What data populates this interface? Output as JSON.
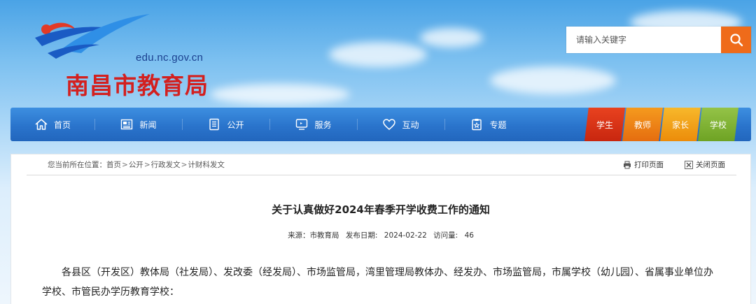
{
  "site": {
    "url": "edu.nc.gov.cn",
    "name": "南昌市教育局"
  },
  "search": {
    "placeholder": "请输入关键字",
    "icon": "search-icon"
  },
  "nav": {
    "items": [
      {
        "label": "首页",
        "icon": "home-icon"
      },
      {
        "label": "新闻",
        "icon": "newspaper-icon"
      },
      {
        "label": "公开",
        "icon": "document-list-icon"
      },
      {
        "label": "服务",
        "icon": "monitor-icon"
      },
      {
        "label": "互动",
        "icon": "heart-icon"
      },
      {
        "label": "专题",
        "icon": "clipboard-icon"
      }
    ],
    "audience_tags": [
      "学生",
      "教师",
      "家长",
      "学校"
    ]
  },
  "breadcrumb": {
    "prefix": "您当前所在位置：",
    "items": [
      "首页",
      "公开",
      "行政发文",
      "计财科发文"
    ],
    "separator": ">"
  },
  "tools": {
    "print": "打印页面",
    "close": "关闭页面"
  },
  "article": {
    "title": "关于认真做好2024年春季开学收费工作的通知",
    "meta": {
      "source_label": "来源：",
      "source": "市教育局",
      "date_label": "发布日期:",
      "date": "2024-02-22",
      "views_label": "访问量:",
      "views": "46"
    },
    "body": "各县区（开发区）教体局（社发局）、发改委（经发局）、市场监管局，湾里管理局教体办、经发办、市场监管局，市属学校（幼儿园）、省属事业单位办学校、市管民办学历教育学校："
  },
  "colors": {
    "nav_blue": "#2a74cc",
    "search_orange": "#ef6b1a",
    "logo_red": "#d3201f",
    "tag_student": "#d9331a",
    "tag_teacher": "#ee8418",
    "tag_parent": "#f2a21c",
    "tag_school": "#82b336"
  }
}
